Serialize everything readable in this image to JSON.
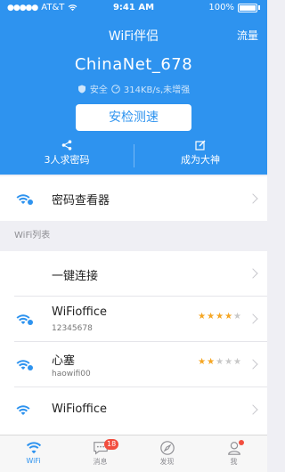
{
  "status_bar": {
    "carrier": "AT&T",
    "time": "9:41 AM",
    "battery": "100%"
  },
  "header": {
    "title": "WiFi伴侣",
    "traffic": "流量"
  },
  "network": {
    "ssid": "ChinaNet_678",
    "security": "安全",
    "speed": "314KB/s,未增强",
    "test_button": "安检测速"
  },
  "actions": [
    {
      "label": "3人求密码",
      "icon": "share-icon"
    },
    {
      "label": "成为大神",
      "icon": "edit-icon"
    }
  ],
  "password_viewer": {
    "label": "密码查看器"
  },
  "wifi_list": {
    "section_title": "WiFi列表",
    "quick_connect": "一键连接",
    "items": [
      {
        "name": "WiFioffice",
        "password": "12345678",
        "rating": 4,
        "max_rating": 5
      },
      {
        "name": "心塞",
        "password": "haowifi00",
        "rating": 2,
        "max_rating": 5
      },
      {
        "name": "WiFioffice",
        "password": "",
        "rating": 0,
        "max_rating": 0
      }
    ]
  },
  "tabbar": {
    "tabs": [
      {
        "label": "WiFi",
        "icon": "wifi-icon",
        "active": true
      },
      {
        "label": "消息",
        "icon": "message-icon",
        "badge": "18"
      },
      {
        "label": "发现",
        "icon": "compass-icon"
      },
      {
        "label": "我",
        "icon": "user-icon",
        "dot": true
      }
    ]
  },
  "colors": {
    "primary": "#2e93ef",
    "star": "#f5a623",
    "badge": "#f24e3f"
  }
}
